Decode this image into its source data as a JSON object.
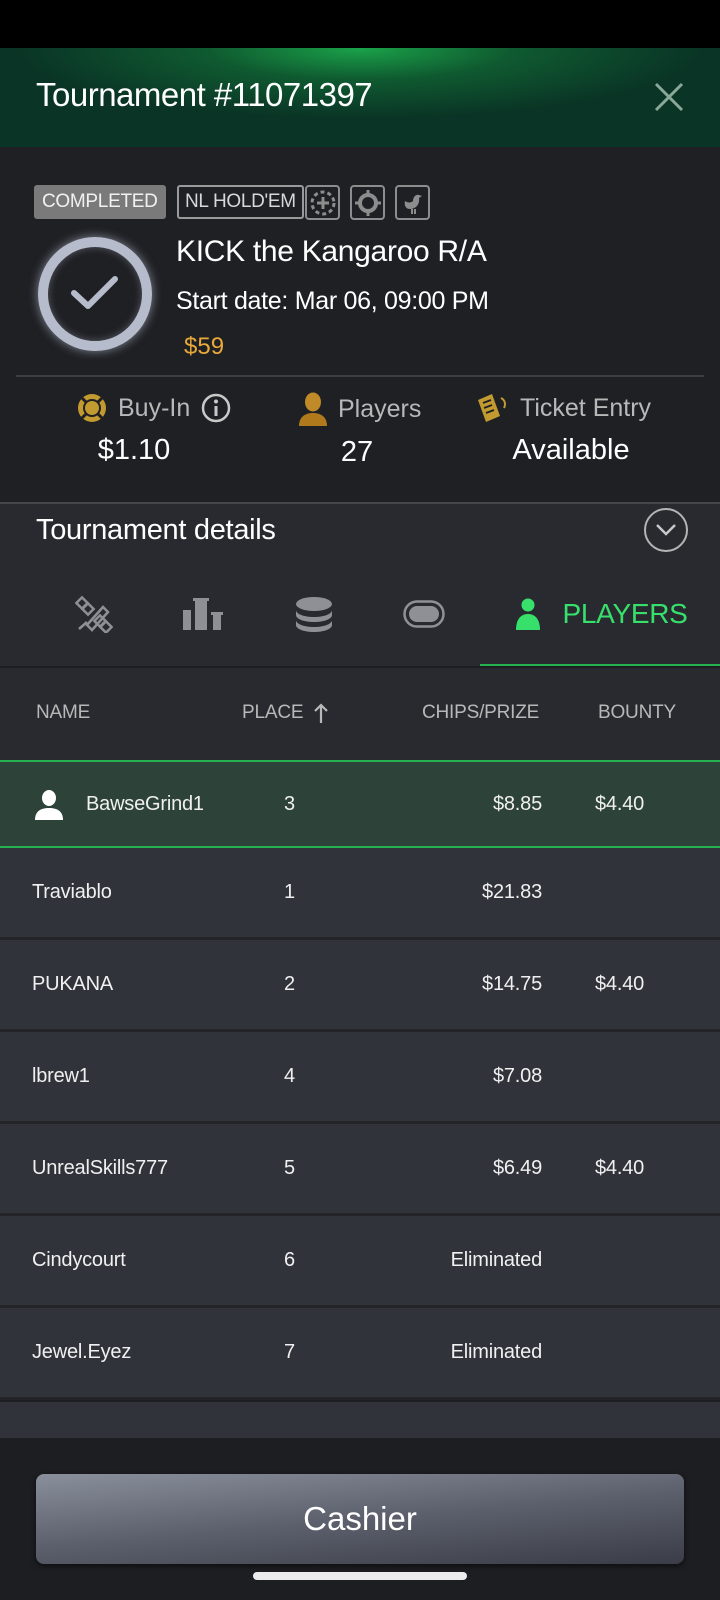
{
  "header": {
    "title": "Tournament #11071397",
    "close_icon": "close-icon"
  },
  "info": {
    "status_badge": "COMPLETED",
    "game_badge": "NL HOLD'EM",
    "feature_icons": [
      "poker-chip-icon",
      "target-icon",
      "bird-icon"
    ],
    "status_icon": "check-circle-icon",
    "name": "KICK the Kangaroo R/A",
    "start_date": "Start date: Mar 06, 09:00 PM",
    "prize_pool": "$59",
    "stats": [
      {
        "label": "Buy-In",
        "value": "$1.10",
        "icon": "buyin-chip-icon",
        "info_icon": "info-icon"
      },
      {
        "label": "Players",
        "value": "27",
        "icon": "player-icon"
      },
      {
        "label": "Ticket Entry",
        "value": "Available",
        "icon": "ticket-icon"
      }
    ]
  },
  "details": {
    "title": "Tournament details",
    "expand_icon": "chevron-down-circle-icon",
    "tabs": [
      {
        "icon": "satellite-icon",
        "label": ""
      },
      {
        "icon": "podium-icon",
        "label": ""
      },
      {
        "icon": "chips-stack-icon",
        "label": ""
      },
      {
        "icon": "table-icon",
        "label": ""
      },
      {
        "icon": "player-icon",
        "label": "PLAYERS",
        "active": true
      }
    ]
  },
  "table": {
    "columns": [
      "NAME",
      "PLACE",
      "CHIPS/PRIZE",
      "BOUNTY"
    ],
    "sort_column": "PLACE",
    "sort_direction": "ascending",
    "rows": [
      {
        "name": "BawseGrind1",
        "place": "3",
        "prize": "$8.85",
        "bounty": "$4.40",
        "is_me": true
      },
      {
        "name": "Traviablo",
        "place": "1",
        "prize": "$21.83",
        "bounty": ""
      },
      {
        "name": "PUKANA",
        "place": "2",
        "prize": "$14.75",
        "bounty": "$4.40"
      },
      {
        "name": "lbrew1",
        "place": "4",
        "prize": "$7.08",
        "bounty": ""
      },
      {
        "name": "UnrealSkills777",
        "place": "5",
        "prize": "$6.49",
        "bounty": "$4.40"
      },
      {
        "name": "Cindycourt",
        "place": "6",
        "prize": "Eliminated",
        "bounty": ""
      },
      {
        "name": "Jewel.Eyez",
        "place": "7",
        "prize": "Eliminated",
        "bounty": ""
      }
    ]
  },
  "footer": {
    "cashier_label": "Cashier"
  },
  "colors": {
    "accent_green": "#25b14f",
    "active_tab_text": "#37e06b",
    "prize_gold": "#e9a93a",
    "highlight_row": "#2d4339"
  }
}
